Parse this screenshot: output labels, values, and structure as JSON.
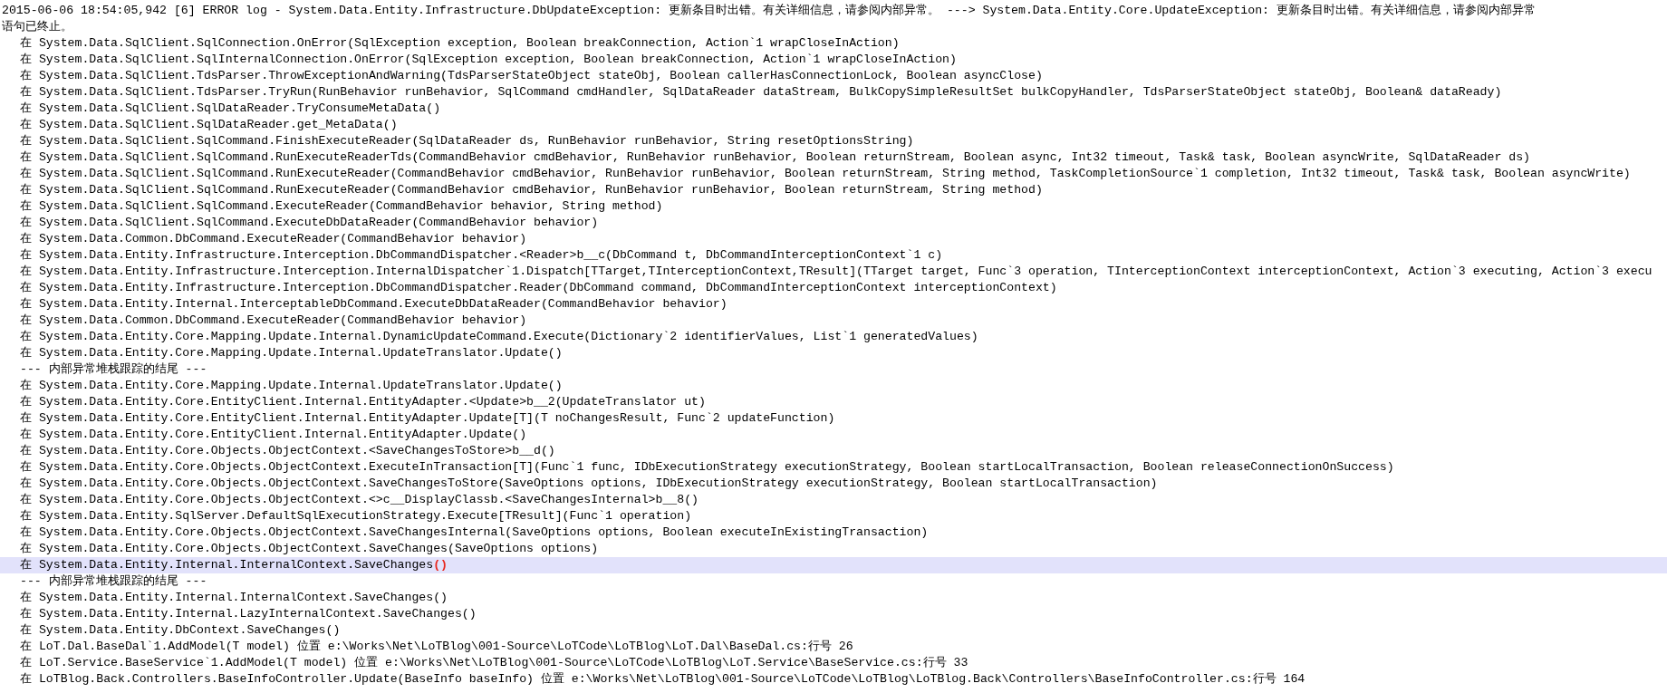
{
  "editor": {
    "lines": [
      {
        "kind": "header",
        "text": "2015-06-06 18:54:05,942 [6] ERROR log - System.Data.Entity.Infrastructure.DbUpdateException: 更新条目时出错。有关详细信息，请参阅内部异常。 ---> System.Data.Entity.Core.UpdateException: 更新条目时出错。有关详细信息，请参阅内部异常",
        "selected": false
      },
      {
        "kind": "header",
        "text": "语句已终止。",
        "selected": false
      },
      {
        "kind": "frame",
        "text": "在 System.Data.SqlClient.SqlConnection.OnError(SqlException exception, Boolean breakConnection, Action`1 wrapCloseInAction)",
        "selected": false
      },
      {
        "kind": "frame",
        "text": "在 System.Data.SqlClient.SqlInternalConnection.OnError(SqlException exception, Boolean breakConnection, Action`1 wrapCloseInAction)",
        "selected": false
      },
      {
        "kind": "frame",
        "text": "在 System.Data.SqlClient.TdsParser.ThrowExceptionAndWarning(TdsParserStateObject stateObj, Boolean callerHasConnectionLock, Boolean asyncClose)",
        "selected": false
      },
      {
        "kind": "frame",
        "text": "在 System.Data.SqlClient.TdsParser.TryRun(RunBehavior runBehavior, SqlCommand cmdHandler, SqlDataReader dataStream, BulkCopySimpleResultSet bulkCopyHandler, TdsParserStateObject stateObj, Boolean& dataReady)",
        "selected": false
      },
      {
        "kind": "frame",
        "text": "在 System.Data.SqlClient.SqlDataReader.TryConsumeMetaData()",
        "selected": false
      },
      {
        "kind": "frame",
        "text": "在 System.Data.SqlClient.SqlDataReader.get_MetaData()",
        "selected": false
      },
      {
        "kind": "frame",
        "text": "在 System.Data.SqlClient.SqlCommand.FinishExecuteReader(SqlDataReader ds, RunBehavior runBehavior, String resetOptionsString)",
        "selected": false
      },
      {
        "kind": "frame",
        "text": "在 System.Data.SqlClient.SqlCommand.RunExecuteReaderTds(CommandBehavior cmdBehavior, RunBehavior runBehavior, Boolean returnStream, Boolean async, Int32 timeout, Task& task, Boolean asyncWrite, SqlDataReader ds)",
        "selected": false
      },
      {
        "kind": "frame",
        "text": "在 System.Data.SqlClient.SqlCommand.RunExecuteReader(CommandBehavior cmdBehavior, RunBehavior runBehavior, Boolean returnStream, String method, TaskCompletionSource`1 completion, Int32 timeout, Task& task, Boolean asyncWrite)",
        "selected": false
      },
      {
        "kind": "frame",
        "text": "在 System.Data.SqlClient.SqlCommand.RunExecuteReader(CommandBehavior cmdBehavior, RunBehavior runBehavior, Boolean returnStream, String method)",
        "selected": false
      },
      {
        "kind": "frame",
        "text": "在 System.Data.SqlClient.SqlCommand.ExecuteReader(CommandBehavior behavior, String method)",
        "selected": false
      },
      {
        "kind": "frame",
        "text": "在 System.Data.SqlClient.SqlCommand.ExecuteDbDataReader(CommandBehavior behavior)",
        "selected": false
      },
      {
        "kind": "frame",
        "text": "在 System.Data.Common.DbCommand.ExecuteReader(CommandBehavior behavior)",
        "selected": false
      },
      {
        "kind": "frame",
        "text": "在 System.Data.Entity.Infrastructure.Interception.DbCommandDispatcher.<Reader>b__c(DbCommand t, DbCommandInterceptionContext`1 c)",
        "selected": false
      },
      {
        "kind": "frame",
        "text": "在 System.Data.Entity.Infrastructure.Interception.InternalDispatcher`1.Dispatch[TTarget,TInterceptionContext,TResult](TTarget target, Func`3 operation, TInterceptionContext interceptionContext, Action`3 executing, Action`3 execu",
        "selected": false
      },
      {
        "kind": "frame",
        "text": "在 System.Data.Entity.Infrastructure.Interception.DbCommandDispatcher.Reader(DbCommand command, DbCommandInterceptionContext interceptionContext)",
        "selected": false
      },
      {
        "kind": "frame",
        "text": "在 System.Data.Entity.Internal.InterceptableDbCommand.ExecuteDbDataReader(CommandBehavior behavior)",
        "selected": false
      },
      {
        "kind": "frame",
        "text": "在 System.Data.Common.DbCommand.ExecuteReader(CommandBehavior behavior)",
        "selected": false
      },
      {
        "kind": "frame",
        "text": "在 System.Data.Entity.Core.Mapping.Update.Internal.DynamicUpdateCommand.Execute(Dictionary`2 identifierValues, List`1 generatedValues)",
        "selected": false
      },
      {
        "kind": "frame",
        "text": "在 System.Data.Entity.Core.Mapping.Update.Internal.UpdateTranslator.Update()",
        "selected": false
      },
      {
        "kind": "separator",
        "text": "--- 内部异常堆栈跟踪的结尾 ---",
        "selected": false
      },
      {
        "kind": "frame",
        "text": "在 System.Data.Entity.Core.Mapping.Update.Internal.UpdateTranslator.Update()",
        "selected": false
      },
      {
        "kind": "frame",
        "text": "在 System.Data.Entity.Core.EntityClient.Internal.EntityAdapter.<Update>b__2(UpdateTranslator ut)",
        "selected": false
      },
      {
        "kind": "frame",
        "text": "在 System.Data.Entity.Core.EntityClient.Internal.EntityAdapter.Update[T](T noChangesResult, Func`2 updateFunction)",
        "selected": false
      },
      {
        "kind": "frame",
        "text": "在 System.Data.Entity.Core.EntityClient.Internal.EntityAdapter.Update()",
        "selected": false
      },
      {
        "kind": "frame",
        "text": "在 System.Data.Entity.Core.Objects.ObjectContext.<SaveChangesToStore>b__d()",
        "selected": false
      },
      {
        "kind": "frame",
        "text": "在 System.Data.Entity.Core.Objects.ObjectContext.ExecuteInTransaction[T](Func`1 func, IDbExecutionStrategy executionStrategy, Boolean startLocalTransaction, Boolean releaseConnectionOnSuccess)",
        "selected": false
      },
      {
        "kind": "frame",
        "text": "在 System.Data.Entity.Core.Objects.ObjectContext.SaveChangesToStore(SaveOptions options, IDbExecutionStrategy executionStrategy, Boolean startLocalTransaction)",
        "selected": false
      },
      {
        "kind": "frame",
        "text": "在 System.Data.Entity.Core.Objects.ObjectContext.<>c__DisplayClassb.<SaveChangesInternal>b__8()",
        "selected": false
      },
      {
        "kind": "frame",
        "text": "在 System.Data.Entity.SqlServer.DefaultSqlExecutionStrategy.Execute[TResult](Func`1 operation)",
        "selected": false
      },
      {
        "kind": "frame",
        "text": "在 System.Data.Entity.Core.Objects.ObjectContext.SaveChangesInternal(SaveOptions options, Boolean executeInExistingTransaction)",
        "selected": false
      },
      {
        "kind": "frame",
        "text": "在 System.Data.Entity.Core.Objects.ObjectContext.SaveChanges(SaveOptions options)",
        "selected": false
      },
      {
        "kind": "frame",
        "text": "在 System.Data.Entity.Internal.InternalContext.SaveChanges",
        "braces": "()",
        "selected": true
      },
      {
        "kind": "separator",
        "text": "--- 内部异常堆栈跟踪的结尾 ---",
        "selected": false
      },
      {
        "kind": "frame",
        "text": "在 System.Data.Entity.Internal.InternalContext.SaveChanges()",
        "selected": false
      },
      {
        "kind": "frame",
        "text": "在 System.Data.Entity.Internal.LazyInternalContext.SaveChanges()",
        "selected": false
      },
      {
        "kind": "frame",
        "text": "在 System.Data.Entity.DbContext.SaveChanges()",
        "selected": false
      },
      {
        "kind": "frame",
        "text": "在 LoT.Dal.BaseDal`1.AddModel(T model) 位置 e:\\Works\\Net\\LoTBlog\\001-Source\\LoTCode\\LoTBlog\\LoT.Dal\\BaseDal.cs:行号 26",
        "selected": false
      },
      {
        "kind": "frame",
        "text": "在 LoT.Service.BaseService`1.AddModel(T model) 位置 e:\\Works\\Net\\LoTBlog\\001-Source\\LoTCode\\LoTBlog\\LoT.Service\\BaseService.cs:行号 33",
        "selected": false
      },
      {
        "kind": "frame",
        "text": "在 LoTBlog.Back.Controllers.BaseInfoController.Update(BaseInfo baseInfo) 位置 e:\\Works\\Net\\LoTBlog\\001-Source\\LoTCode\\LoTBlog\\LoTBlog.Back\\Controllers\\BaseInfoController.cs:行号 164",
        "selected": false
      }
    ]
  }
}
